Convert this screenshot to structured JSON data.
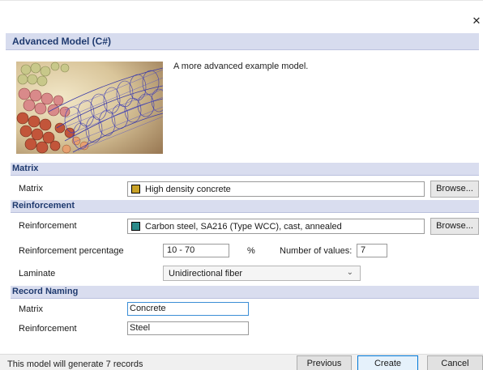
{
  "window": {
    "close_glyph": "✕"
  },
  "model": {
    "title": "Advanced Model (C#)",
    "description": "A more advanced example model.",
    "thumbnail": "nanotube-image"
  },
  "matrix_section": {
    "title": "Matrix",
    "label": "Matrix",
    "material": "High density concrete",
    "material_color": "#c9a227",
    "browse": "Browse..."
  },
  "reinforcement_section": {
    "title": "Reinforcement",
    "label": "Reinforcement",
    "material": "Carbon steel, SA216 (Type WCC), cast, annealed",
    "material_color": "#2a8a8a",
    "browse": "Browse...",
    "percentage_label": "Reinforcement percentage",
    "percentage_value": "10 - 70",
    "percentage_unit": "%",
    "num_values_label": "Number of values:",
    "num_values": "7",
    "laminate_label": "Laminate",
    "laminate_value": "Unidirectional fiber"
  },
  "record_naming": {
    "title": "Record Naming",
    "matrix_label": "Matrix",
    "matrix_value": "Concrete",
    "reinforcement_label": "Reinforcement",
    "reinforcement_value": "Steel"
  },
  "footer": {
    "status": "This model will generate 7 records",
    "previous": "Previous",
    "create": "Create",
    "cancel": "Cancel"
  }
}
